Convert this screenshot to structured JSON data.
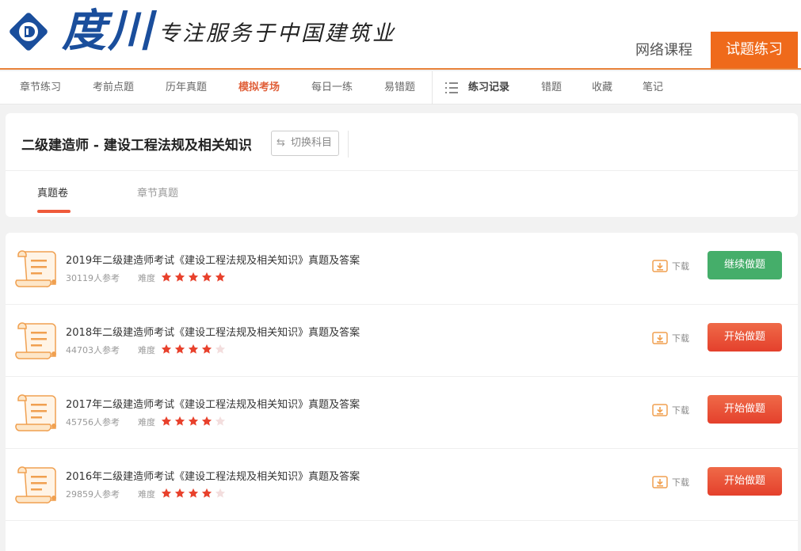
{
  "header": {
    "logo_text": "度川",
    "slogan": "专注服务于中国建筑业",
    "nav_links": [
      "网络课程",
      "试题练习"
    ]
  },
  "nav": {
    "items": [
      "章节练习",
      "考前点题",
      "历年真题",
      "模拟考场",
      "每日一练",
      "易错题"
    ],
    "active": "模拟考场",
    "record_label": "练习记录",
    "extra_items": [
      "错题",
      "收藏",
      "笔记"
    ]
  },
  "subject": {
    "title": "二级建造师 - 建设工程法规及相关知识",
    "switch_label": "切换科目",
    "tabs": [
      "真题卷",
      "章节真题"
    ],
    "active_tab": "真题卷"
  },
  "papers": [
    {
      "title": "2019年二级建造师考试《建设工程法规及相关知识》真题及答案",
      "count": "30119人参考",
      "difficulty_label": "难度",
      "stars": 5,
      "download_label": "下载",
      "action_label": "继续做题",
      "action_type": "continue"
    },
    {
      "title": "2018年二级建造师考试《建设工程法规及相关知识》真题及答案",
      "count": "44703人参考",
      "difficulty_label": "难度",
      "stars": 4,
      "download_label": "下载",
      "action_label": "开始做题",
      "action_type": "start"
    },
    {
      "title": "2017年二级建造师考试《建设工程法规及相关知识》真题及答案",
      "count": "45756人参考",
      "difficulty_label": "难度",
      "stars": 4,
      "download_label": "下载",
      "action_label": "开始做题",
      "action_type": "start"
    },
    {
      "title": "2016年二级建造师考试《建设工程法规及相关知识》真题及答案",
      "count": "29859人参考",
      "difficulty_label": "难度",
      "stars": 4,
      "download_label": "下载",
      "action_label": "开始做题",
      "action_type": "start"
    }
  ],
  "colors": {
    "brand_blue": "#1a4e9c",
    "accent_orange": "#ef6a1b",
    "active_red": "#e0603a",
    "star_filled": "#e8412c",
    "star_empty": "#f3dede",
    "continue_green": "#45ae6a"
  }
}
